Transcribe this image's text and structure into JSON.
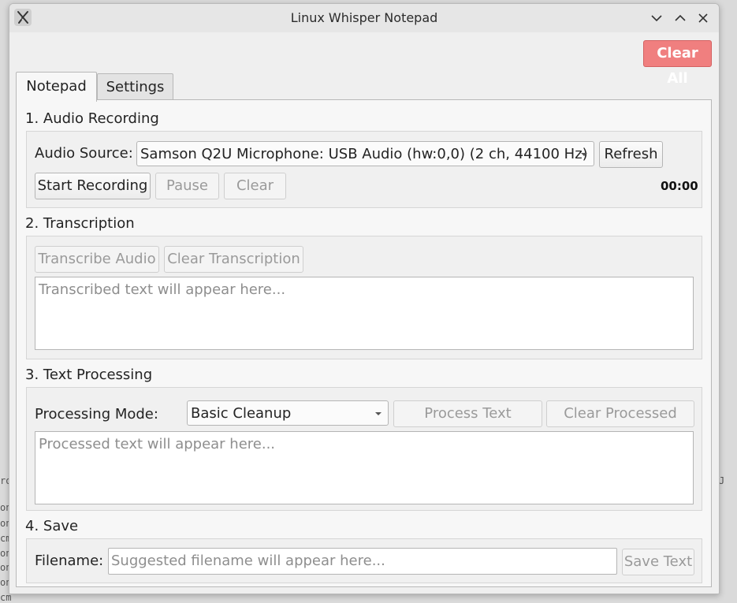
{
  "background": {
    "lines": [
      "ro",
      "on",
      "on",
      "cm",
      "on",
      "on",
      "on",
      "cm"
    ],
    "right_glyph": "J"
  },
  "window": {
    "title": "Linux Whisper Notepad",
    "icons": {
      "app": "app-x-icon",
      "minimize": "chevron-down-icon",
      "maximize": "chevron-up-icon",
      "close": "close-icon"
    }
  },
  "toolbar": {
    "clear_all_label": "Clear All",
    "clear_all_color": "#f07f7f"
  },
  "tabs": [
    {
      "label": "Notepad",
      "active": true
    },
    {
      "label": "Settings",
      "active": false
    }
  ],
  "recording": {
    "title": "1. Audio Recording",
    "source_label": "Audio Source:",
    "source_value": "Samson Q2U Microphone: USB Audio (hw:0,0) (2 ch, 44100 Hz)",
    "refresh_label": "Refresh",
    "start_label": "Start Recording",
    "pause_label": "Pause",
    "clear_label": "Clear",
    "timer": "00:00"
  },
  "transcription": {
    "title": "2. Transcription",
    "transcribe_label": "Transcribe Audio",
    "clear_label": "Clear Transcription",
    "placeholder": "Transcribed text will appear here..."
  },
  "processing": {
    "title": "3. Text Processing",
    "mode_label": "Processing Mode:",
    "mode_value": "Basic Cleanup",
    "process_label": "Process Text",
    "clear_label": "Clear Processed",
    "placeholder": "Processed text will appear here..."
  },
  "save": {
    "title": "4. Save",
    "filename_label": "Filename:",
    "filename_placeholder": "Suggested filename will appear here...",
    "save_label": "Save Text"
  }
}
